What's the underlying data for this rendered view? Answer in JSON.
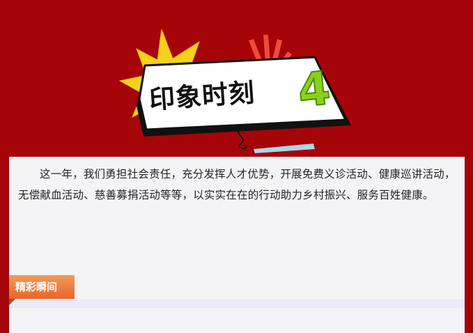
{
  "header": {
    "title": "印象时刻",
    "title_number": "4"
  },
  "intro": {
    "text": "这一年，我们勇担社会责任，充分发挥人才优势，开展免费义诊活动、健康巡讲活动，无偿献血活动、慈善募捐活动等等，以实实在在的行动助力乡村振兴、服务百姓健康。"
  },
  "section": {
    "label": "精彩瞬间"
  },
  "colors": {
    "background": "#a50508",
    "card": "#f4f4f6",
    "accent_orange": "#e8642b",
    "title_green": "#8bd11b",
    "burst_yellow": "#f7d01c"
  }
}
